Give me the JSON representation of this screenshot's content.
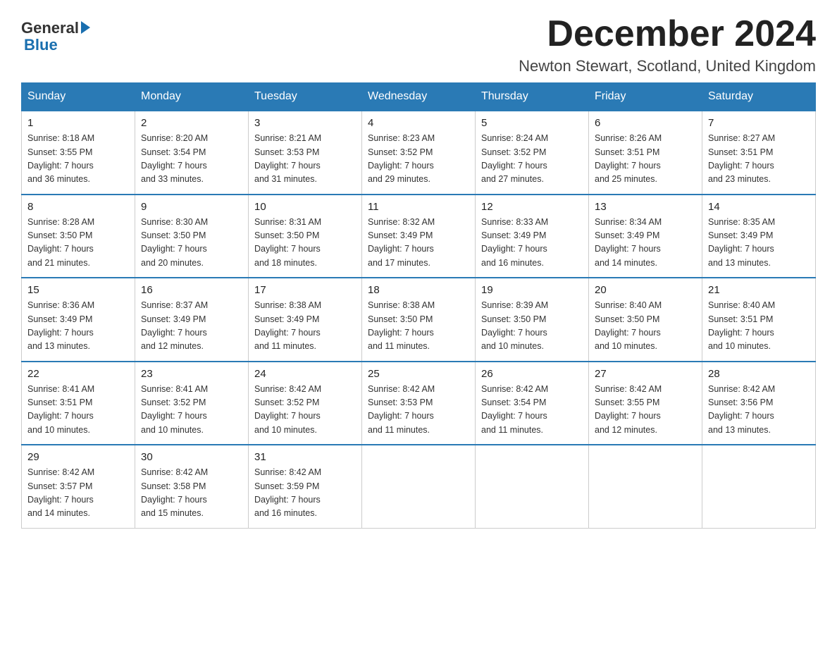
{
  "logo": {
    "general": "General",
    "blue": "Blue"
  },
  "header": {
    "month": "December 2024",
    "location": "Newton Stewart, Scotland, United Kingdom"
  },
  "days_of_week": [
    "Sunday",
    "Monday",
    "Tuesday",
    "Wednesday",
    "Thursday",
    "Friday",
    "Saturday"
  ],
  "weeks": [
    [
      {
        "day": "1",
        "sunrise": "8:18 AM",
        "sunset": "3:55 PM",
        "daylight": "7 hours and 36 minutes."
      },
      {
        "day": "2",
        "sunrise": "8:20 AM",
        "sunset": "3:54 PM",
        "daylight": "7 hours and 33 minutes."
      },
      {
        "day": "3",
        "sunrise": "8:21 AM",
        "sunset": "3:53 PM",
        "daylight": "7 hours and 31 minutes."
      },
      {
        "day": "4",
        "sunrise": "8:23 AM",
        "sunset": "3:52 PM",
        "daylight": "7 hours and 29 minutes."
      },
      {
        "day": "5",
        "sunrise": "8:24 AM",
        "sunset": "3:52 PM",
        "daylight": "7 hours and 27 minutes."
      },
      {
        "day": "6",
        "sunrise": "8:26 AM",
        "sunset": "3:51 PM",
        "daylight": "7 hours and 25 minutes."
      },
      {
        "day": "7",
        "sunrise": "8:27 AM",
        "sunset": "3:51 PM",
        "daylight": "7 hours and 23 minutes."
      }
    ],
    [
      {
        "day": "8",
        "sunrise": "8:28 AM",
        "sunset": "3:50 PM",
        "daylight": "7 hours and 21 minutes."
      },
      {
        "day": "9",
        "sunrise": "8:30 AM",
        "sunset": "3:50 PM",
        "daylight": "7 hours and 20 minutes."
      },
      {
        "day": "10",
        "sunrise": "8:31 AM",
        "sunset": "3:50 PM",
        "daylight": "7 hours and 18 minutes."
      },
      {
        "day": "11",
        "sunrise": "8:32 AM",
        "sunset": "3:49 PM",
        "daylight": "7 hours and 17 minutes."
      },
      {
        "day": "12",
        "sunrise": "8:33 AM",
        "sunset": "3:49 PM",
        "daylight": "7 hours and 16 minutes."
      },
      {
        "day": "13",
        "sunrise": "8:34 AM",
        "sunset": "3:49 PM",
        "daylight": "7 hours and 14 minutes."
      },
      {
        "day": "14",
        "sunrise": "8:35 AM",
        "sunset": "3:49 PM",
        "daylight": "7 hours and 13 minutes."
      }
    ],
    [
      {
        "day": "15",
        "sunrise": "8:36 AM",
        "sunset": "3:49 PM",
        "daylight": "7 hours and 13 minutes."
      },
      {
        "day": "16",
        "sunrise": "8:37 AM",
        "sunset": "3:49 PM",
        "daylight": "7 hours and 12 minutes."
      },
      {
        "day": "17",
        "sunrise": "8:38 AM",
        "sunset": "3:49 PM",
        "daylight": "7 hours and 11 minutes."
      },
      {
        "day": "18",
        "sunrise": "8:38 AM",
        "sunset": "3:50 PM",
        "daylight": "7 hours and 11 minutes."
      },
      {
        "day": "19",
        "sunrise": "8:39 AM",
        "sunset": "3:50 PM",
        "daylight": "7 hours and 10 minutes."
      },
      {
        "day": "20",
        "sunrise": "8:40 AM",
        "sunset": "3:50 PM",
        "daylight": "7 hours and 10 minutes."
      },
      {
        "day": "21",
        "sunrise": "8:40 AM",
        "sunset": "3:51 PM",
        "daylight": "7 hours and 10 minutes."
      }
    ],
    [
      {
        "day": "22",
        "sunrise": "8:41 AM",
        "sunset": "3:51 PM",
        "daylight": "7 hours and 10 minutes."
      },
      {
        "day": "23",
        "sunrise": "8:41 AM",
        "sunset": "3:52 PM",
        "daylight": "7 hours and 10 minutes."
      },
      {
        "day": "24",
        "sunrise": "8:42 AM",
        "sunset": "3:52 PM",
        "daylight": "7 hours and 10 minutes."
      },
      {
        "day": "25",
        "sunrise": "8:42 AM",
        "sunset": "3:53 PM",
        "daylight": "7 hours and 11 minutes."
      },
      {
        "day": "26",
        "sunrise": "8:42 AM",
        "sunset": "3:54 PM",
        "daylight": "7 hours and 11 minutes."
      },
      {
        "day": "27",
        "sunrise": "8:42 AM",
        "sunset": "3:55 PM",
        "daylight": "7 hours and 12 minutes."
      },
      {
        "day": "28",
        "sunrise": "8:42 AM",
        "sunset": "3:56 PM",
        "daylight": "7 hours and 13 minutes."
      }
    ],
    [
      {
        "day": "29",
        "sunrise": "8:42 AM",
        "sunset": "3:57 PM",
        "daylight": "7 hours and 14 minutes."
      },
      {
        "day": "30",
        "sunrise": "8:42 AM",
        "sunset": "3:58 PM",
        "daylight": "7 hours and 15 minutes."
      },
      {
        "day": "31",
        "sunrise": "8:42 AM",
        "sunset": "3:59 PM",
        "daylight": "7 hours and 16 minutes."
      },
      null,
      null,
      null,
      null
    ]
  ],
  "labels": {
    "sunrise": "Sunrise:",
    "sunset": "Sunset:",
    "daylight": "Daylight:"
  }
}
